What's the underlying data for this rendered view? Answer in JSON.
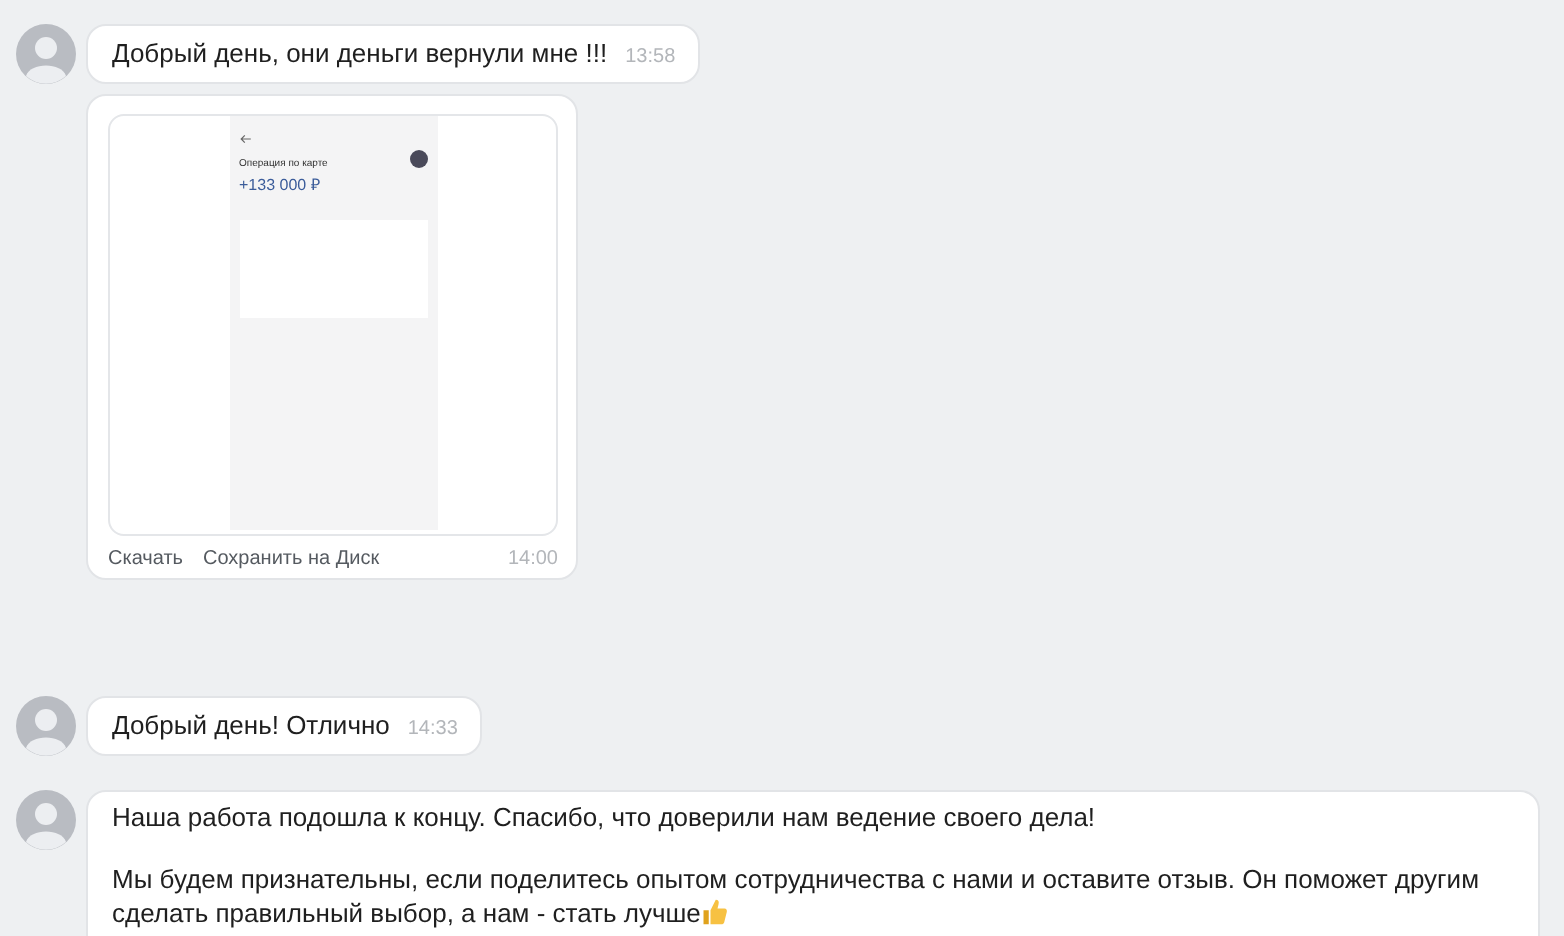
{
  "messages": [
    {
      "kind": "text",
      "avatar": true,
      "text": "Добрый день, они деньги вернули мне !!!",
      "time": "13:58"
    },
    {
      "kind": "image",
      "avatar": false,
      "screenshot": {
        "title": "Операция по карте",
        "amount": "+133 000 ₽"
      },
      "actions": [
        "Скачать",
        "Сохранить на Диск"
      ],
      "time": "14:00"
    },
    {
      "kind": "text",
      "avatar": true,
      "text": "Добрый день! Отлично",
      "time": "14:33"
    },
    {
      "kind": "long",
      "avatar": true,
      "paragraphs": [
        "Наша работа подошла к концу. Спасибо, что доверили нам ведение своего дела!",
        "Мы будем признательны, если поделитесь опытом сотрудничества с нами и оставите отзыв. Он поможет другим сделать правильный выбор, а нам - стать лучше"
      ]
    }
  ]
}
